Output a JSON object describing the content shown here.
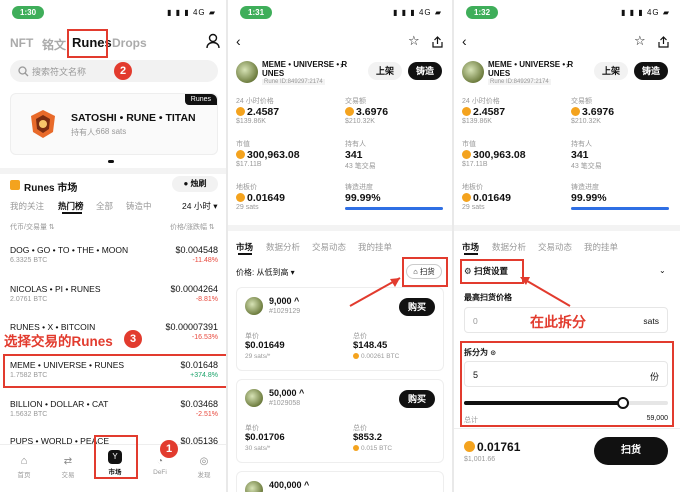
{
  "p1": {
    "time": "1:30",
    "tabs": [
      "NFT",
      "铭文",
      "Runes",
      "Drops"
    ],
    "search_placeholder": "搜索符文名称",
    "banner": {
      "badge": "Runes",
      "title": "SATOSHI • RUNE • TITAN",
      "holders_label": "持有人:",
      "holders_value": "668 sats"
    },
    "market_title": "Runes 市场",
    "flash_label": "● 烛刷",
    "subtabs": [
      "我的关注",
      "热门榜",
      "全部",
      "铸造中"
    ],
    "period": "24 小时",
    "col_left": "代币/交易量 ⇅",
    "col_right": "价格/涨跌幅 ⇅",
    "rows": [
      {
        "name": "DOG • GO • TO • THE • MOON",
        "vol": "6.3325 BTC",
        "price": "$0.004548",
        "chg": "-11.48%",
        "up": false
      },
      {
        "name": "NICOLAS • PI • RUNES",
        "vol": "2.0761 BTC",
        "price": "$0.0004264",
        "chg": "-8.81%",
        "up": false
      },
      {
        "name": "RUNES • X • BITCOIN",
        "vol": "",
        "price": "$0.00007391",
        "chg": "-16.53%",
        "up": false
      },
      {
        "name": "MEME • UNIVERSE • RUNES",
        "vol": "1.7582 BTC",
        "price": "$0.01648",
        "chg": "+374.8%",
        "up": true
      },
      {
        "name": "BILLION • DOLLAR • CAT",
        "vol": "1.5632 BTC",
        "price": "$0.03468",
        "chg": "-2.51%",
        "up": false
      },
      {
        "name": "PUPS • WORLD • PEACE",
        "vol": "",
        "price": "$0.05136",
        "chg": "",
        "up": false
      }
    ],
    "annot_select": "选择交易的Runes",
    "nav": [
      "首页",
      "交易",
      "市场",
      "DeFi",
      "发现"
    ],
    "annot_nums": [
      "1",
      "2",
      "3"
    ]
  },
  "p2": {
    "time": "1:31",
    "name_line1": "MEME • UNIVERSE • R",
    "name_line2": "UNES",
    "rune_id": "Rune ID:849297:2174",
    "btn_list": "上架",
    "btn_mint": "铸造",
    "stats": [
      {
        "label": "24 小时价格",
        "value": "2.4587",
        "sub": "$139.86K",
        "coin": true
      },
      {
        "label": "交易额",
        "value": "3.6976",
        "sub": "$210.32K",
        "coin": true
      },
      {
        "label": "市值",
        "value": "300,963.08",
        "sub": "$17.11B",
        "coin": true
      },
      {
        "label": "持有人",
        "value": "341",
        "sub": "43 笔交易",
        "coin": false
      },
      {
        "label": "地板价",
        "value": "0.01649",
        "sub": "29 sats",
        "coin": true
      },
      {
        "label": "铸造进度",
        "value": "99.99%",
        "sub": "",
        "coin": false
      }
    ],
    "tabs": [
      "市场",
      "数据分析",
      "交易动态",
      "我的挂单"
    ],
    "sort_label": "价格: 从低到高",
    "sweep_label": "扫货",
    "listings": [
      {
        "qty": "9,000",
        "id": "#1029129",
        "buy": "购买",
        "unit_label": "单价",
        "unit": "$0.01649",
        "unit_sats": "29 sats/*",
        "total_label": "总价",
        "total": "$148.45",
        "total_btc": "0.00261 BTC"
      },
      {
        "qty": "50,000",
        "id": "#1029058",
        "buy": "购买",
        "unit_label": "单价",
        "unit": "$0.01706",
        "unit_sats": "30 sats/*",
        "total_label": "总价",
        "total": "$853.2",
        "total_btc": "0.015 BTC"
      },
      {
        "qty": "400,000",
        "id": "",
        "buy": "",
        "unit_label": "",
        "unit": "",
        "unit_sats": "",
        "total_label": "",
        "total": "",
        "total_btc": ""
      }
    ]
  },
  "p3": {
    "time": "1:32",
    "sweep_settings": "扫货设置",
    "max_price_label": "最高扫货价格",
    "max_price_placeholder": "0",
    "unit": "sats",
    "split_label": "拆分为",
    "split_value": "5",
    "split_unit": "份",
    "total_label": "总计",
    "total_value": "59,000",
    "slider_pct": 0.78,
    "bottom_price": "0.01761",
    "bottom_usd": "$1,001.66",
    "sweep_btn": "扫货",
    "annot_split": "在此拆分"
  },
  "colors": {
    "annot": "#e23b2e",
    "up": "#1aa36a",
    "down": "#e8483c",
    "accent": "#f4a31e"
  }
}
